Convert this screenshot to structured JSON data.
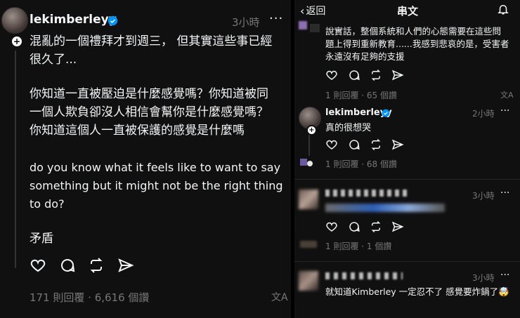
{
  "left": {
    "username": "lekimberleyy",
    "time": "3小時",
    "more": "···",
    "paragraphs": [
      [
        "混亂的一個禮拜才到週三，  但其實這些事已經",
        "很久了..."
      ],
      [
        "你知道一直被壓迫是什麼感覺嗎？你知道被同",
        "一個人欺負卻沒人相信會幫你是什麼感覺嗎？",
        "你知道這個人一直被保護的感覺是什麼嗎"
      ],
      [
        "do you know what it feels like to want to say",
        "something but it might not be the right thing",
        "to do?"
      ],
      [
        "矛盾"
      ]
    ],
    "stats": "171 則回覆 · 6,616 個讚",
    "translate_icon": "文A"
  },
  "right": {
    "header": {
      "back": "返回",
      "title": "串文"
    },
    "reply_top": {
      "lines": [
        "說實話，整個系統和人們的心態需要在這些問",
        "題上得到重新教育......我感到悲哀的是，受害者",
        "永遠沒有足夠的支援"
      ],
      "stats": "1 則回覆 · 65 個讚"
    },
    "reply_main": {
      "username": "lekimberleyy",
      "time": "2小時",
      "text": "真的很想哭",
      "stats": "1 則回覆 · 68 個讚"
    },
    "reply_a": {
      "time": "3小時",
      "stats": "1 則回覆 · 1 個讚"
    },
    "reply_b": {
      "time": "3小時",
      "text": "就知道Kimberley 一定忍不了 感覺要炸鍋了🤯"
    },
    "more": "···"
  },
  "colors": {
    "bg": "#101010",
    "text": "#f3f5f7",
    "muted": "#777777",
    "verified": "#0095f6"
  }
}
